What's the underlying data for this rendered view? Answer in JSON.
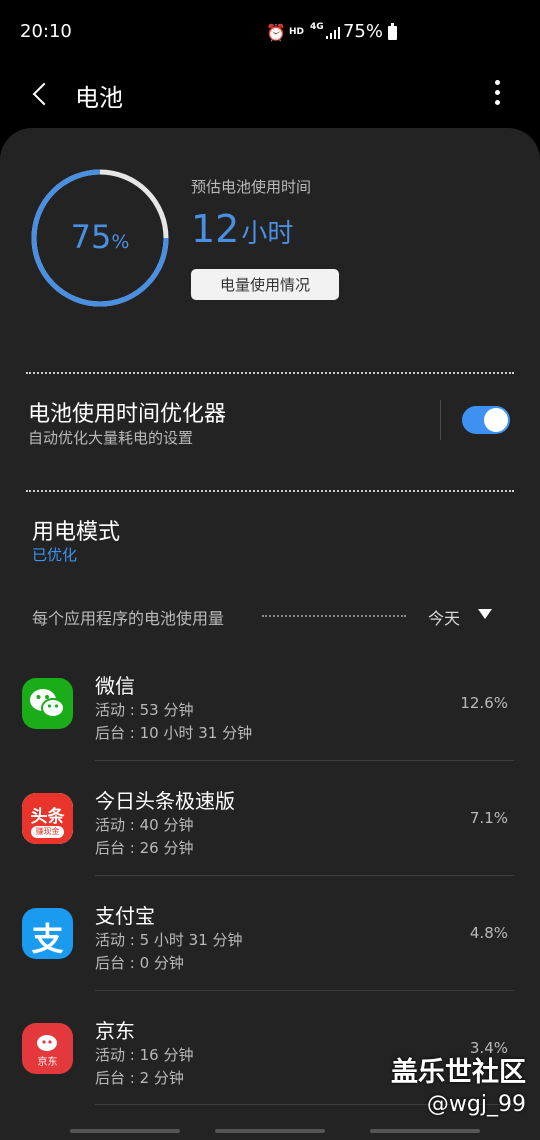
{
  "status_bar": {
    "time": "20:10",
    "hd": "HD",
    "network": "4G",
    "battery": "75%"
  },
  "header": {
    "title": "电池"
  },
  "battery": {
    "level_percent": 75,
    "level_value": "75",
    "level_unit": "%",
    "estimate_label": "预估电池使用时间",
    "estimate_value": "12",
    "estimate_unit": "小时",
    "usage_button": "电量使用情况",
    "ring_color": "#4a90e2"
  },
  "optimizer": {
    "title": "电池使用时间优化器",
    "subtitle": "自动优化大量耗电的设置",
    "enabled": true
  },
  "power_mode": {
    "title": "用电模式",
    "status": "已优化"
  },
  "usage_section": {
    "label": "每个应用程序的电池使用量",
    "period": "今天"
  },
  "apps": [
    {
      "name": "微信",
      "active": "活动 : 53 分钟",
      "background": "后台 : 10 小时 31 分钟",
      "percent": "12.6%",
      "icon": "wechat-icon"
    },
    {
      "name": "今日头条极速版",
      "active": "活动 : 40 分钟",
      "background": "后台 : 26 分钟",
      "percent": "7.1%",
      "icon": "toutiao-icon",
      "icon_text": "头条",
      "icon_subtext": "赚现金"
    },
    {
      "name": "支付宝",
      "active": "活动 : 5 小时 31 分钟",
      "background": "后台 : 0 分钟",
      "percent": "4.8%",
      "icon": "alipay-icon",
      "icon_text": "支"
    },
    {
      "name": "京东",
      "active": "活动 : 16 分钟",
      "background": "后台 : 2 分钟",
      "percent": "3.4%",
      "icon": "jd-icon",
      "icon_text": "京东"
    }
  ],
  "watermark": {
    "site": "盖乐世社区",
    "user": "@wgj_99"
  }
}
